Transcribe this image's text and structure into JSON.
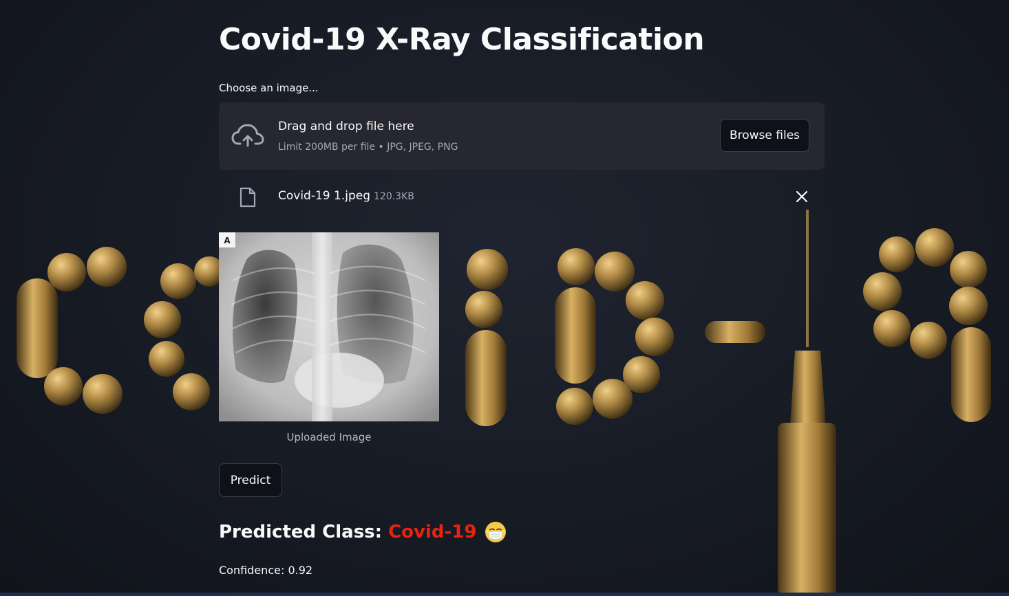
{
  "page": {
    "title": "Covid-19 X-Ray Classification"
  },
  "uploader": {
    "label": "Choose an image...",
    "dropzone_title": "Drag and drop file here",
    "dropzone_limit": "Limit 200MB per file • JPG, JPEG, PNG",
    "browse_label": "Browse files"
  },
  "uploaded_file": {
    "name": "Covid-19 1.jpeg",
    "size": "120.3KB"
  },
  "image": {
    "corner_marker": "A",
    "caption": "Uploaded Image"
  },
  "actions": {
    "predict_label": "Predict"
  },
  "result": {
    "prefix": "Predicted Class:",
    "class_name": "Covid-19",
    "class_color": "#e8230f",
    "emoji": "face-with-medical-mask",
    "confidence_text": "Confidence: 0.92"
  },
  "icons": {
    "upload": "cloud-upload-icon",
    "file": "file-icon",
    "remove": "close-icon"
  },
  "colors": {
    "background": "#171b24",
    "dropzone": "#262730",
    "button_bg": "#0e1117",
    "button_border": "#3d404a",
    "muted_text": "#a3a8b8",
    "pill_gold": "#b08a45"
  }
}
